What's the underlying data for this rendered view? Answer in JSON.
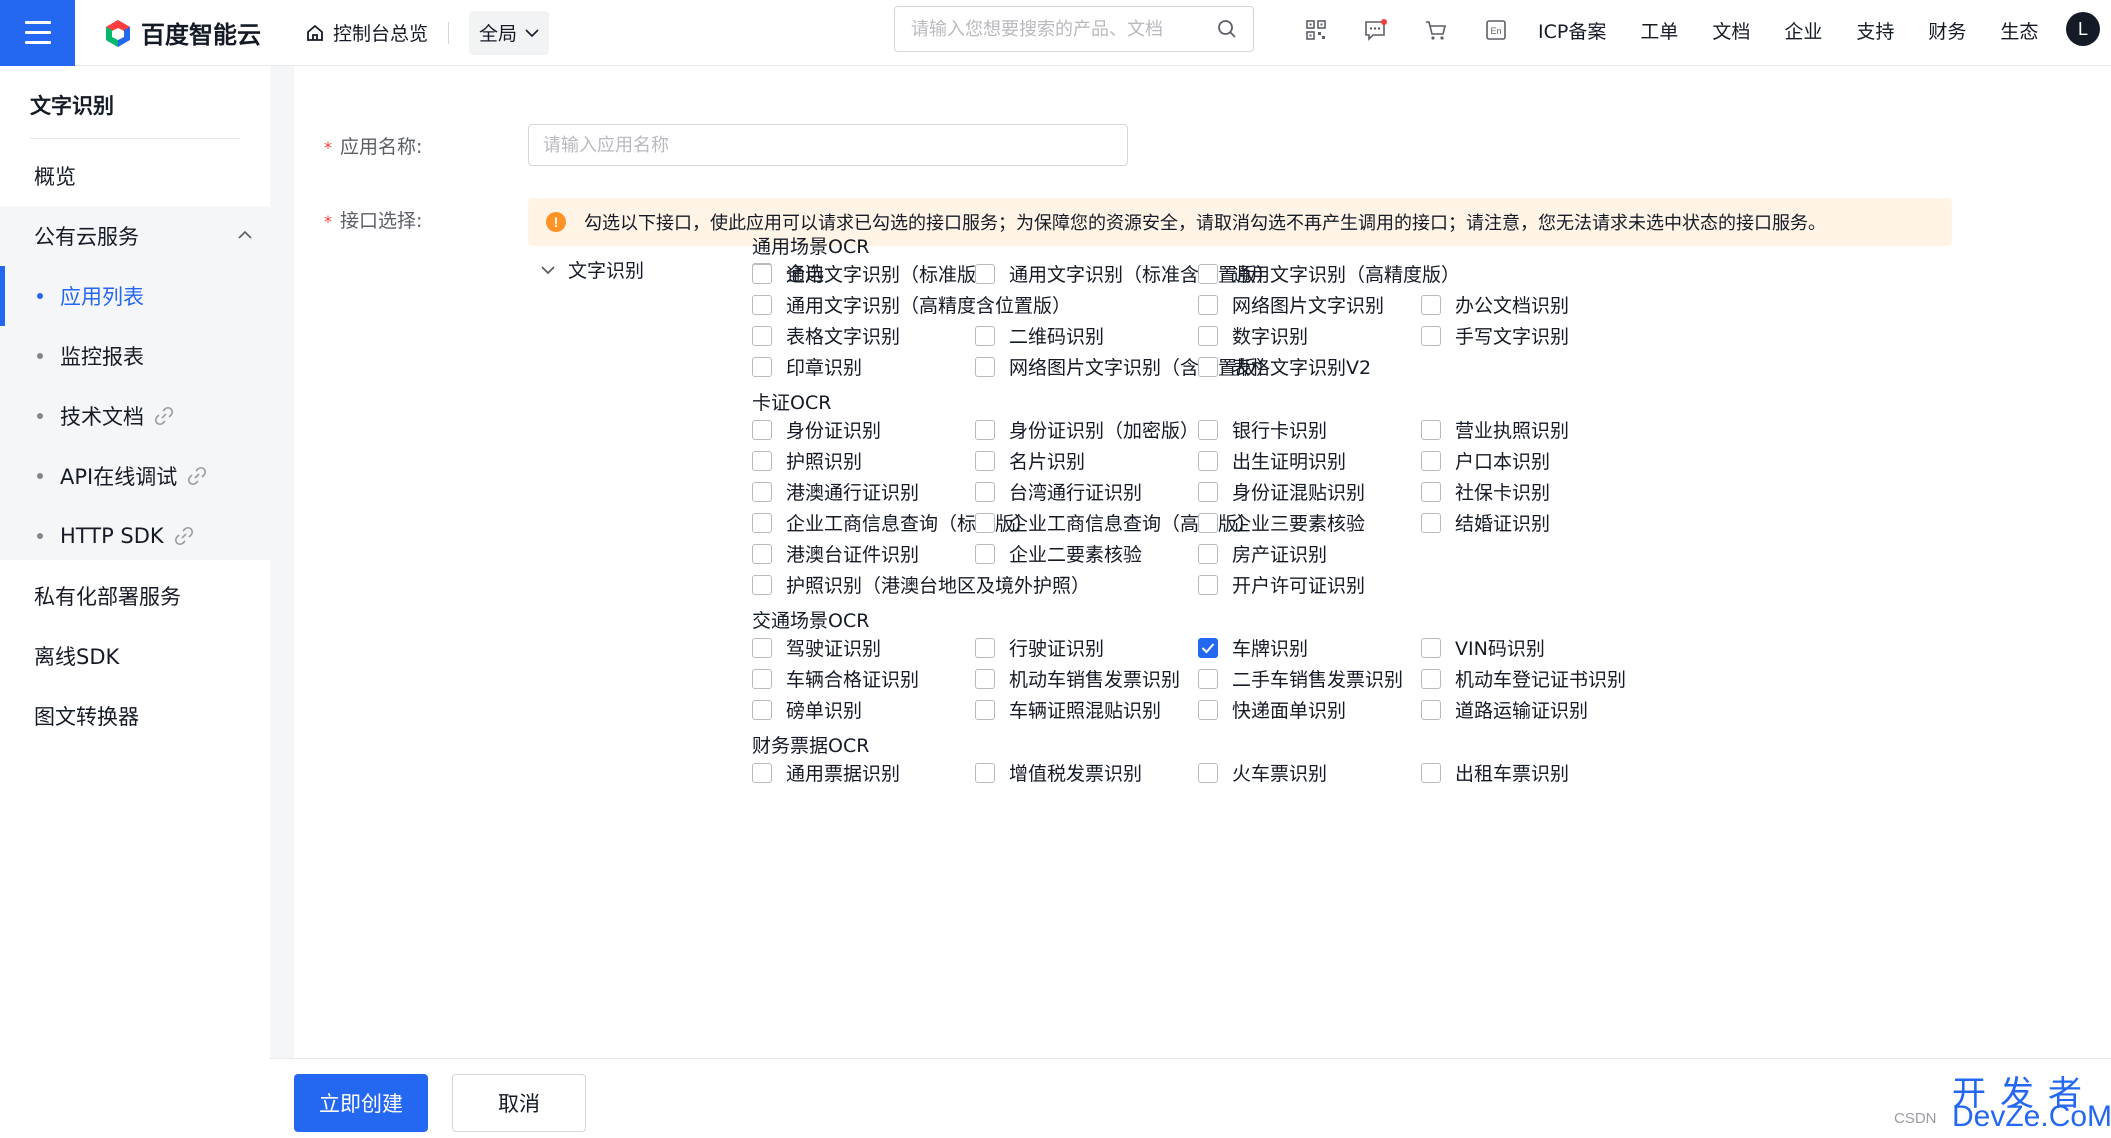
{
  "topbar": {
    "logo_text": "百度智能云",
    "home_label": "控制台总览",
    "scope_label": "全局",
    "search_placeholder": "请输入您想要搜索的产品、文档",
    "icons": [
      "qrcode-icon",
      "message-icon",
      "cart-icon",
      "language-en-icon"
    ],
    "nav": [
      "ICP备案",
      "工单",
      "文档",
      "企业",
      "支持",
      "财务",
      "生态"
    ],
    "avatar_letter": "L"
  },
  "sidebar": {
    "title": "文字识别",
    "items": {
      "overview": "概览",
      "public_cloud": "公有云服务",
      "app_list": "应用列表",
      "monitor": "监控报表",
      "tech_docs": "技术文档",
      "api_debug": "API在线调试",
      "http_sdk": "HTTP SDK",
      "private_deploy": "私有化部署服务",
      "offline_sdk": "离线SDK",
      "img_convert": "图文转换器"
    }
  },
  "form": {
    "name_label": "应用名称:",
    "name_placeholder": "请输入应用名称",
    "api_label": "接口选择:",
    "notice": "勾选以下接口，使此应用可以请求已勾选的接口服务；为保障您的资源安全，请取消勾选不再产生调用的接口；请注意，您无法请求未选中状态的接口服务。",
    "tree_root": "文字识别",
    "select_all": "全选",
    "groups": [
      {
        "title": "通用场景OCR",
        "items": [
          {
            "label": "通用文字识别（标准版）",
            "checked": false
          },
          {
            "label": "通用文字识别（标准含位置版）",
            "checked": false
          },
          {
            "label": "通用文字识别（高精度版）",
            "checked": false
          },
          {
            "label": "通用文字识别（高精度含位置版）",
            "checked": false
          },
          {
            "label": "网络图片文字识别",
            "checked": false
          },
          {
            "label": "办公文档识别",
            "checked": false
          },
          {
            "label": "表格文字识别",
            "checked": false
          },
          {
            "label": "二维码识别",
            "checked": false
          },
          {
            "label": "数字识别",
            "checked": false
          },
          {
            "label": "手写文字识别",
            "checked": false
          },
          {
            "label": "印章识别",
            "checked": false
          },
          {
            "label": "网络图片文字识别（含位置版）",
            "checked": false
          },
          {
            "label": "表格文字识别V2",
            "checked": false
          }
        ]
      },
      {
        "title": "卡证OCR",
        "items": [
          {
            "label": "身份证识别",
            "checked": false
          },
          {
            "label": "身份证识别（加密版）",
            "checked": false
          },
          {
            "label": "银行卡识别",
            "checked": false
          },
          {
            "label": "营业执照识别",
            "checked": false
          },
          {
            "label": "护照识别",
            "checked": false
          },
          {
            "label": "名片识别",
            "checked": false
          },
          {
            "label": "出生证明识别",
            "checked": false
          },
          {
            "label": "户口本识别",
            "checked": false
          },
          {
            "label": "港澳通行证识别",
            "checked": false
          },
          {
            "label": "台湾通行证识别",
            "checked": false
          },
          {
            "label": "身份证混贴识别",
            "checked": false
          },
          {
            "label": "社保卡识别",
            "checked": false
          },
          {
            "label": "企业工商信息查询（标准版）",
            "checked": false
          },
          {
            "label": "企业工商信息查询（高级版）",
            "checked": false
          },
          {
            "label": "企业三要素核验",
            "checked": false
          },
          {
            "label": "结婚证识别",
            "checked": false
          },
          {
            "label": "港澳台证件识别",
            "checked": false
          },
          {
            "label": "企业二要素核验",
            "checked": false
          },
          {
            "label": "房产证识别",
            "checked": false
          },
          {
            "label": "护照识别（港澳台地区及境外护照）",
            "checked": false
          },
          {
            "label": "开户许可证识别",
            "checked": false
          }
        ]
      },
      {
        "title": "交通场景OCR",
        "items": [
          {
            "label": "驾驶证识别",
            "checked": false
          },
          {
            "label": "行驶证识别",
            "checked": false
          },
          {
            "label": "车牌识别",
            "checked": true
          },
          {
            "label": "VIN码识别",
            "checked": false
          },
          {
            "label": "车辆合格证识别",
            "checked": false
          },
          {
            "label": "机动车销售发票识别",
            "checked": false
          },
          {
            "label": "二手车销售发票识别",
            "checked": false
          },
          {
            "label": "机动车登记证书识别",
            "checked": false
          },
          {
            "label": "磅单识别",
            "checked": false
          },
          {
            "label": "车辆证照混贴识别",
            "checked": false
          },
          {
            "label": "快递面单识别",
            "checked": false
          },
          {
            "label": "道路运输证识别",
            "checked": false
          }
        ]
      },
      {
        "title": "财务票据OCR",
        "items": [
          {
            "label": "通用票据识别",
            "checked": false
          },
          {
            "label": "增值税发票识别",
            "checked": false
          },
          {
            "label": "火车票识别",
            "checked": false
          },
          {
            "label": "出租车票识别",
            "checked": false
          }
        ]
      }
    ]
  },
  "footer": {
    "create_label": "立即创建",
    "cancel_label": "取消"
  },
  "watermark": {
    "csdn": "CSDN",
    "top": "开发者",
    "bottom": "DevZe.CoM"
  },
  "colors": {
    "primary": "#2468f2",
    "warning": "#ff9326",
    "required": "#f33e3e"
  }
}
